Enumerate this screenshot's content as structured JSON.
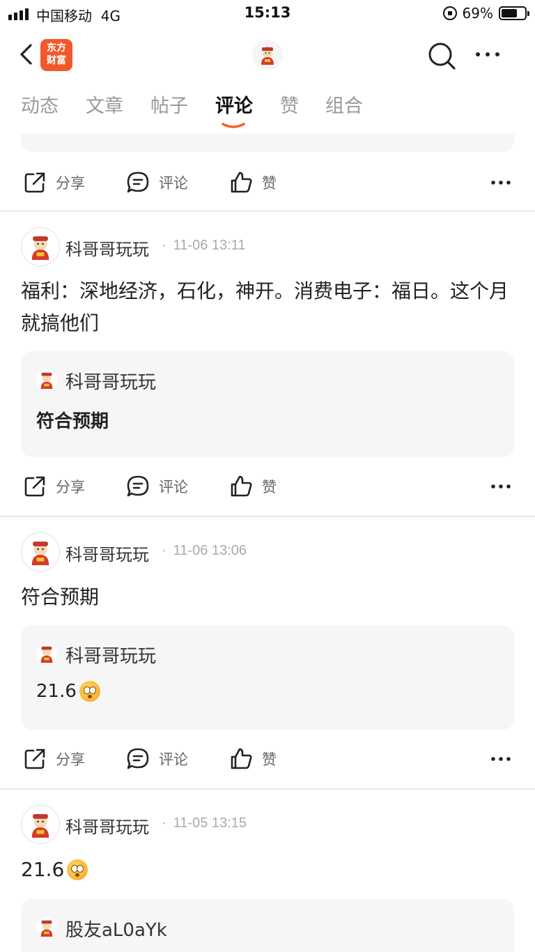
{
  "status_bar": {
    "carrier": "中国移动",
    "network": "4G",
    "time": "15:13",
    "battery_percent": "69%",
    "battery_level": 0.69
  },
  "nav": {
    "back_icon": "chevron-left-icon",
    "logo_line1": "东方",
    "logo_line2": "财富",
    "logo_color": "#f2592a",
    "search_icon": "search-icon",
    "more_icon": "more-horizontal-icon"
  },
  "tabs": [
    {
      "label": "动态",
      "active": false
    },
    {
      "label": "文章",
      "active": false
    },
    {
      "label": "帖子",
      "active": false
    },
    {
      "label": "评论",
      "active": true
    },
    {
      "label": "赞",
      "active": false
    },
    {
      "label": "组合",
      "active": false
    }
  ],
  "accent_color": "#ff5a1f",
  "actions": {
    "share": "分享",
    "comment": "评论",
    "like": "赞"
  },
  "posts": [
    {
      "author": "科哥哥玩玩",
      "time": "11-06 13:11",
      "text": "福利：深地经济，石化，神开。消费电子：福日。这个月就搞他们",
      "quote_author": "科哥哥玩玩",
      "quote_text": "符合预期"
    },
    {
      "author": "科哥哥玩玩",
      "time": "11-06 13:06",
      "text": "符合预期",
      "quote_author": "科哥哥玩玩",
      "quote_text": "21.6"
    },
    {
      "author": "科哥哥玩玩",
      "time": "11-05 13:15",
      "text": "21.6",
      "quote_author": "股友aL0aYk",
      "quote_text": ""
    }
  ]
}
